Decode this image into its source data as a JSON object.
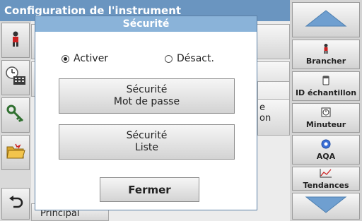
{
  "background": {
    "title": "Configuration de l'instrument",
    "items": [
      "e",
      "e",
      "on",
      "Principal"
    ]
  },
  "left_icons": [
    "person-icon",
    "clock-keyboard-icon",
    "key-icon",
    "folder-icon",
    "back-arrow-icon"
  ],
  "right_toolbar": {
    "up": "up-arrow-icon",
    "buttons": [
      {
        "icon": "person-icon",
        "label": "Brancher"
      },
      {
        "icon": "sample-vial-icon",
        "label": "ID échantillon"
      },
      {
        "icon": "timer-icon",
        "label": "Minuteur"
      },
      {
        "icon": "aqa-icon",
        "label": "AQA"
      },
      {
        "icon": "trend-chart-icon",
        "label": "Tendances"
      }
    ],
    "down": "down-arrow-icon"
  },
  "dialog": {
    "title": "Sécurité",
    "radio_on": "Activer",
    "radio_off": "Désact.",
    "selected": "Activer",
    "button1": {
      "line1": "Sécurité",
      "line2": "Mot de passe"
    },
    "button2": {
      "line1": "Sécurité",
      "line2": "Liste"
    },
    "close": "Fermer"
  },
  "colors": {
    "title_bar": "#6a95c0",
    "dialog_title": "#8ab3d9",
    "arrow": "#6f9fd0"
  }
}
